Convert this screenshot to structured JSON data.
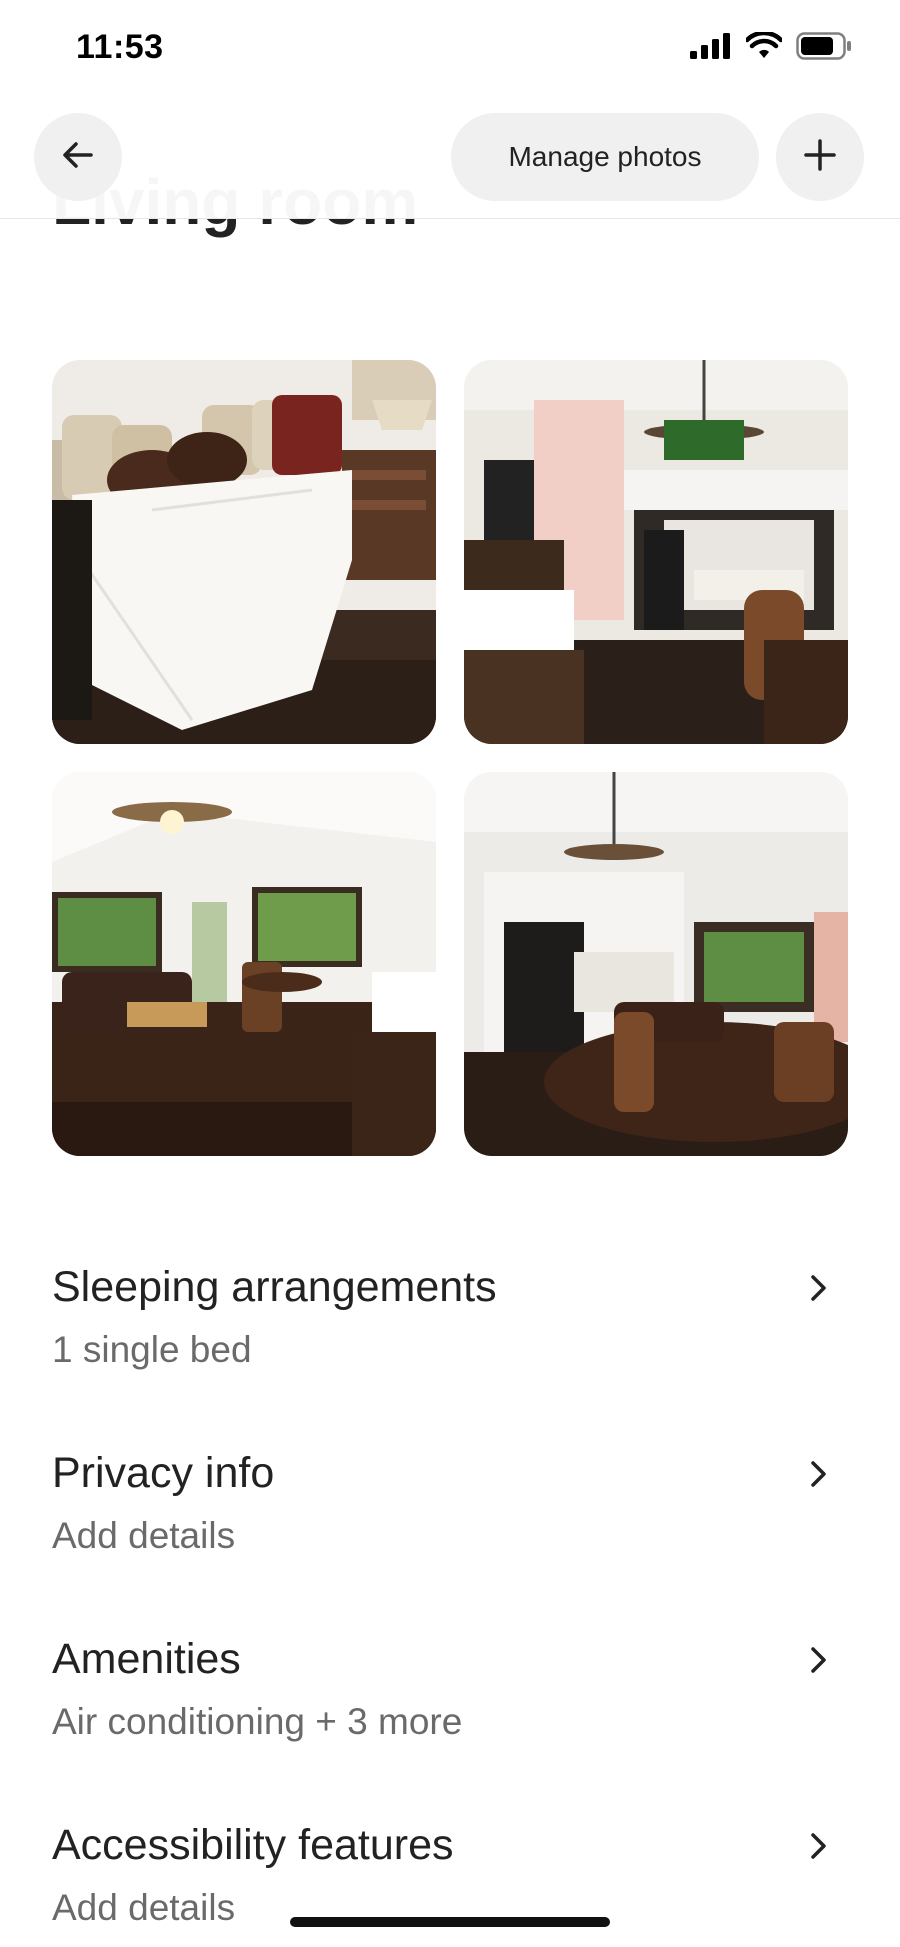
{
  "status": {
    "time": "11:53"
  },
  "header": {
    "manage_photos_label": "Manage photos"
  },
  "page": {
    "title": "Living room"
  },
  "photos": [
    {
      "alt": "Day bed with pillows"
    },
    {
      "alt": "Room with TV and kitchenette"
    },
    {
      "alt": "Living area with sofa and ceiling fan"
    },
    {
      "alt": "Room overview with dining table"
    }
  ],
  "sections": [
    {
      "title": "Sleeping arrangements",
      "subtitle": "1 single bed"
    },
    {
      "title": "Privacy info",
      "subtitle": "Add details"
    },
    {
      "title": "Amenities",
      "subtitle": "Air conditioning + 3 more"
    },
    {
      "title": "Accessibility features",
      "subtitle": "Add details"
    }
  ],
  "icons": {
    "back": "arrow-left-icon",
    "add": "plus-icon",
    "chevron": "chevron-right-icon"
  }
}
